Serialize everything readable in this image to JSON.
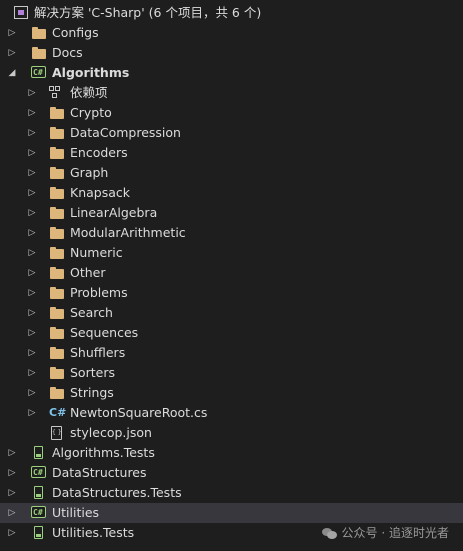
{
  "solution": {
    "label": "解决方案 'C-Sharp' (6 个项目，共 6 个)"
  },
  "tree": {
    "configs": "Configs",
    "docs": "Docs",
    "algorithms": "Algorithms",
    "algorithms_children": {
      "deps": "依赖项",
      "crypto": "Crypto",
      "datacompression": "DataCompression",
      "encoders": "Encoders",
      "graph": "Graph",
      "knapsack": "Knapsack",
      "linearalgebra": "LinearAlgebra",
      "modulararithmetic": "ModularArithmetic",
      "numeric": "Numeric",
      "other": "Other",
      "problems": "Problems",
      "search": "Search",
      "sequences": "Sequences",
      "shufflers": "Shufflers",
      "sorters": "Sorters",
      "strings": "Strings",
      "newtonsquareroot": "NewtonSquareRoot.cs",
      "stylecop": "stylecop.json"
    },
    "algorithms_tests": "Algorithms.Tests",
    "datastructures": "DataStructures",
    "datastructures_tests": "DataStructures.Tests",
    "utilities": "Utilities",
    "utilities_tests": "Utilities.Tests"
  },
  "icons": {
    "project_icon_text": "C#",
    "file_icon_text": "C#",
    "json_icon_text": "{ }"
  },
  "watermark": "公众号 · 追逐时光者",
  "colors": {
    "background": "#1e1e1e",
    "selected_row": "#37373d",
    "folder": "#dcb67a",
    "csharp_project": "#9ad17c",
    "csharp_file": "#7fc3ea"
  }
}
